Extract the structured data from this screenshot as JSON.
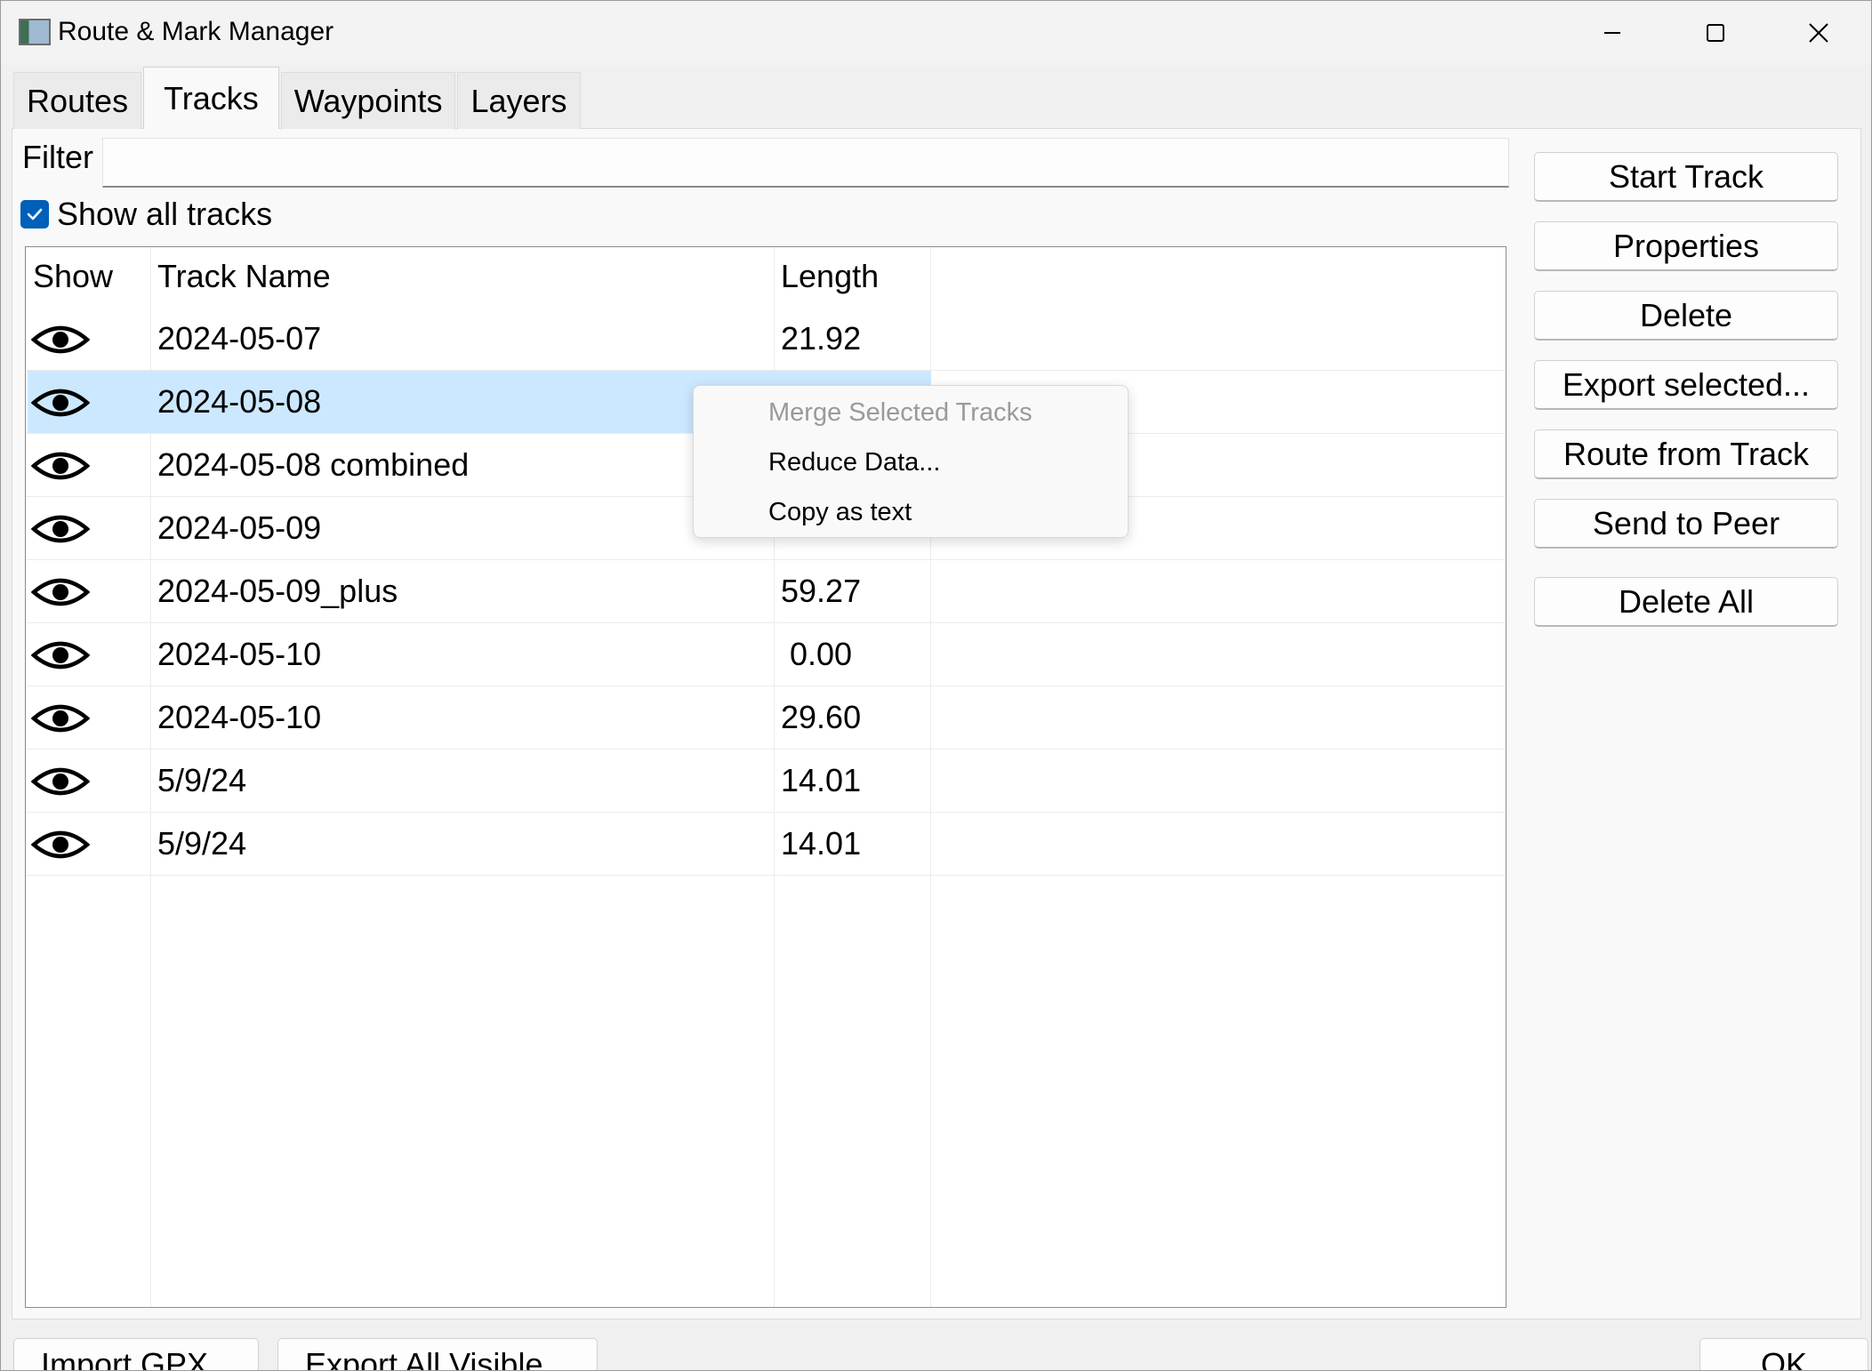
{
  "window": {
    "title": "Route & Mark Manager",
    "controls": [
      "minimize",
      "maximize",
      "close"
    ]
  },
  "tabs": [
    {
      "label": "Routes",
      "active": false
    },
    {
      "label": "Tracks",
      "active": true
    },
    {
      "label": "Waypoints",
      "active": false
    },
    {
      "label": "Layers",
      "active": false
    }
  ],
  "filter": {
    "label": "Filter",
    "value": ""
  },
  "show_all": {
    "label": "Show all tracks",
    "checked": true
  },
  "table": {
    "headers": {
      "show": "Show",
      "name": "Track Name",
      "length": "Length"
    },
    "rows": [
      {
        "name": "2024-05-07",
        "length": "21.92",
        "selected": false
      },
      {
        "name": "2024-05-08",
        "length": "",
        "selected": true
      },
      {
        "name": "2024-05-08 combined",
        "length": "",
        "selected": false
      },
      {
        "name": "2024-05-09",
        "length": "",
        "selected": false
      },
      {
        "name": "2024-05-09_plus",
        "length": "59.27",
        "selected": false
      },
      {
        "name": "2024-05-10",
        "length": " 0.00",
        "selected": false
      },
      {
        "name": "2024-05-10",
        "length": "29.60",
        "selected": false
      },
      {
        "name": "5/9/24",
        "length": "14.01",
        "selected": false
      },
      {
        "name": "5/9/24",
        "length": "14.01",
        "selected": false
      }
    ]
  },
  "side_buttons": {
    "start_track": "Start Track",
    "properties": "Properties",
    "delete": "Delete",
    "export_selected": "Export selected...",
    "route_from_track": "Route from Track",
    "send_to_peer": "Send to Peer",
    "delete_all": "Delete All"
  },
  "bottom_buttons": {
    "import_gpx": "Import GPX",
    "export_all_visible": "Export All Visible",
    "ok": "OK"
  },
  "context_menu": {
    "items": [
      {
        "label": "Merge Selected Tracks",
        "enabled": false
      },
      {
        "label": "Reduce Data...",
        "enabled": true
      },
      {
        "label": "Copy as text",
        "enabled": true
      }
    ]
  },
  "colors": {
    "accent": "#005fb8",
    "selection": "#cce8ff",
    "disabled_text": "#9a9a9a"
  }
}
